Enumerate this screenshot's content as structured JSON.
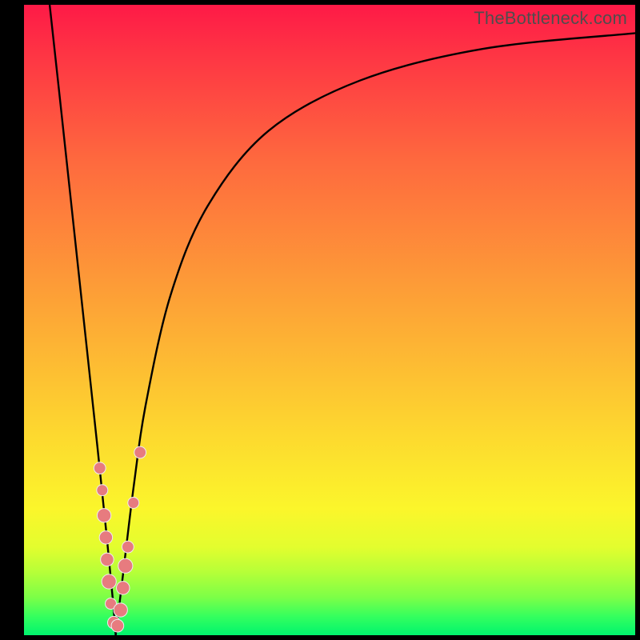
{
  "watermark": "TheBottleneck.com",
  "colors": {
    "frame": "#000000",
    "curve": "#000000",
    "marker_fill": "#e77b7f",
    "marker_stroke": "#eceef0",
    "gradient_stops": [
      "#fe1a47",
      "#fe6a3e",
      "#fd9d37",
      "#fdd82f",
      "#fbf62b",
      "#b6ff38",
      "#00f46e"
    ]
  },
  "chart_data": {
    "type": "line",
    "title": "",
    "xlabel": "",
    "ylabel": "",
    "xlim": [
      0,
      100
    ],
    "ylim": [
      0,
      100
    ],
    "grid": false,
    "notch_x": 15,
    "series": [
      {
        "name": "left-branch",
        "x": [
          4.2,
          6,
          8,
          10,
          12,
          13.5,
          14.5,
          15
        ],
        "y": [
          100,
          84,
          66,
          48,
          30,
          16,
          6,
          0
        ]
      },
      {
        "name": "right-branch",
        "x": [
          15,
          16,
          18,
          20,
          24,
          30,
          40,
          55,
          75,
          100
        ],
        "y": [
          0,
          8,
          24,
          37,
          54,
          68,
          80,
          88,
          93,
          95.5
        ]
      }
    ],
    "markers": {
      "name": "sample-points",
      "points": [
        {
          "x": 12.4,
          "y": 26.5,
          "r": 1.0
        },
        {
          "x": 12.8,
          "y": 23.0,
          "r": 0.9
        },
        {
          "x": 13.1,
          "y": 19.0,
          "r": 1.3
        },
        {
          "x": 13.4,
          "y": 15.5,
          "r": 1.2
        },
        {
          "x": 13.6,
          "y": 12.0,
          "r": 1.2
        },
        {
          "x": 13.9,
          "y": 8.5,
          "r": 1.4
        },
        {
          "x": 14.2,
          "y": 5.0,
          "r": 0.9
        },
        {
          "x": 14.7,
          "y": 2.0,
          "r": 1.1
        },
        {
          "x": 15.3,
          "y": 1.5,
          "r": 1.1
        },
        {
          "x": 15.8,
          "y": 4.0,
          "r": 1.3
        },
        {
          "x": 16.2,
          "y": 7.5,
          "r": 1.2
        },
        {
          "x": 16.6,
          "y": 11.0,
          "r": 1.4
        },
        {
          "x": 17.0,
          "y": 14.0,
          "r": 1.0
        },
        {
          "x": 17.9,
          "y": 21.0,
          "r": 0.9
        },
        {
          "x": 19.0,
          "y": 29.0,
          "r": 1.0
        }
      ]
    }
  }
}
